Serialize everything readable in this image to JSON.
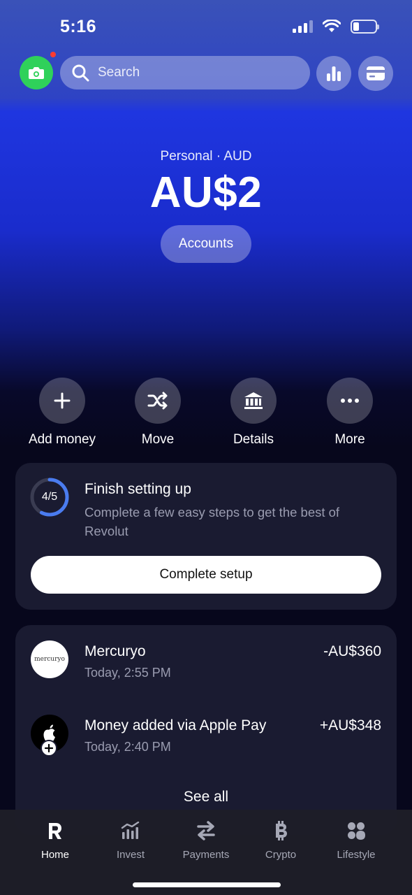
{
  "status": {
    "time": "5:16"
  },
  "search": {
    "placeholder": "Search"
  },
  "account": {
    "label": "Personal · AUD",
    "balance": "AU$2",
    "accounts_button": "Accounts"
  },
  "actions": [
    {
      "label": "Add money",
      "icon": "plus-icon"
    },
    {
      "label": "Move",
      "icon": "shuffle-icon"
    },
    {
      "label": "Details",
      "icon": "bank-icon"
    },
    {
      "label": "More",
      "icon": "more-dots-icon"
    }
  ],
  "setup": {
    "progress_text": "4/5",
    "progress": 0.8,
    "title": "Finish setting up",
    "description": "Complete a few easy steps to get the best of Revolut",
    "button": "Complete setup"
  },
  "transactions": [
    {
      "merchant_logo_text": "mercuryo",
      "name": "Mercuryo",
      "time": "Today, 2:55 PM",
      "amount": "-AU$360"
    },
    {
      "name": "Money added via Apple Pay",
      "time": "Today, 2:40 PM",
      "amount": "+AU$348"
    }
  ],
  "see_all": "See all",
  "tabs": [
    {
      "label": "Home",
      "icon": "revolut-r-icon",
      "active": true
    },
    {
      "label": "Invest",
      "icon": "invest-chart-icon",
      "active": false
    },
    {
      "label": "Payments",
      "icon": "arrows-exchange-icon",
      "active": false
    },
    {
      "label": "Crypto",
      "icon": "bitcoin-icon",
      "active": false
    },
    {
      "label": "Lifestyle",
      "icon": "lifestyle-grid-icon",
      "active": false
    }
  ],
  "colors": {
    "accent_green": "#2fd15a",
    "notification_red": "#ff3b30",
    "card_bg": "#1a1b31",
    "progress_blue": "#4a7cf0"
  }
}
